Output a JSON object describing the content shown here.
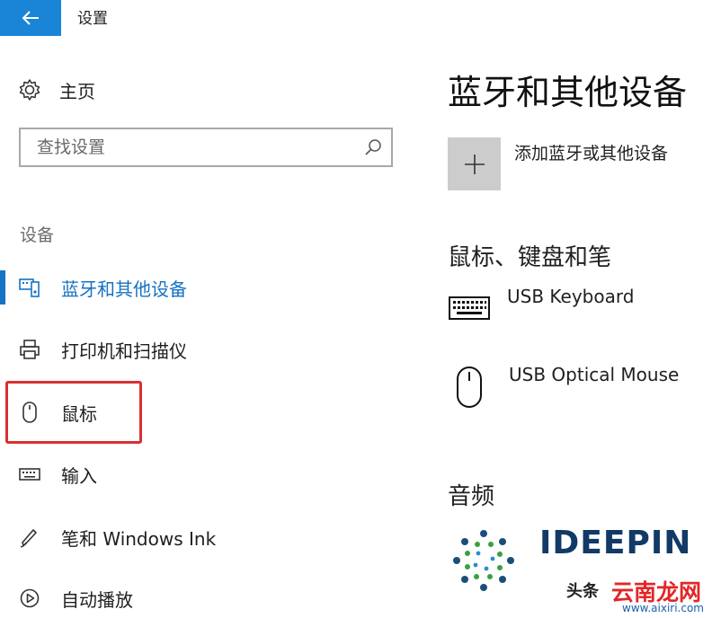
{
  "window": {
    "title": "设置"
  },
  "sidebar": {
    "home_label": "主页",
    "search_placeholder": "查找设置",
    "section_label": "设备",
    "items": [
      {
        "label": "蓝牙和其他设备",
        "icon": "bluetooth-devices-icon",
        "active": true
      },
      {
        "label": "打印机和扫描仪",
        "icon": "printer-icon",
        "active": false
      },
      {
        "label": "鼠标",
        "icon": "mouse-icon",
        "active": false
      },
      {
        "label": "输入",
        "icon": "keyboard-icon",
        "active": false
      },
      {
        "label": "笔和 Windows Ink",
        "icon": "pen-icon",
        "active": false
      },
      {
        "label": "自动播放",
        "icon": "autoplay-icon",
        "active": false
      }
    ]
  },
  "main": {
    "title": "蓝牙和其他设备",
    "add_device_label": "添加蓝牙或其他设备",
    "sections": [
      {
        "heading": "鼠标、键盘和笔",
        "devices": [
          {
            "name": "USB Keyboard",
            "icon": "keyboard-icon"
          },
          {
            "name": "USB Optical Mouse",
            "icon": "mouse-icon"
          }
        ]
      },
      {
        "heading": "音频"
      }
    ]
  },
  "watermark": {
    "brand": "IDEEPIN",
    "caption_left": "头条",
    "caption_right": "云南龙网",
    "url": "www.aixiri.com"
  },
  "colors": {
    "accent": "#1672c2",
    "back_button": "#1a85d6",
    "highlight": "#d83030"
  }
}
